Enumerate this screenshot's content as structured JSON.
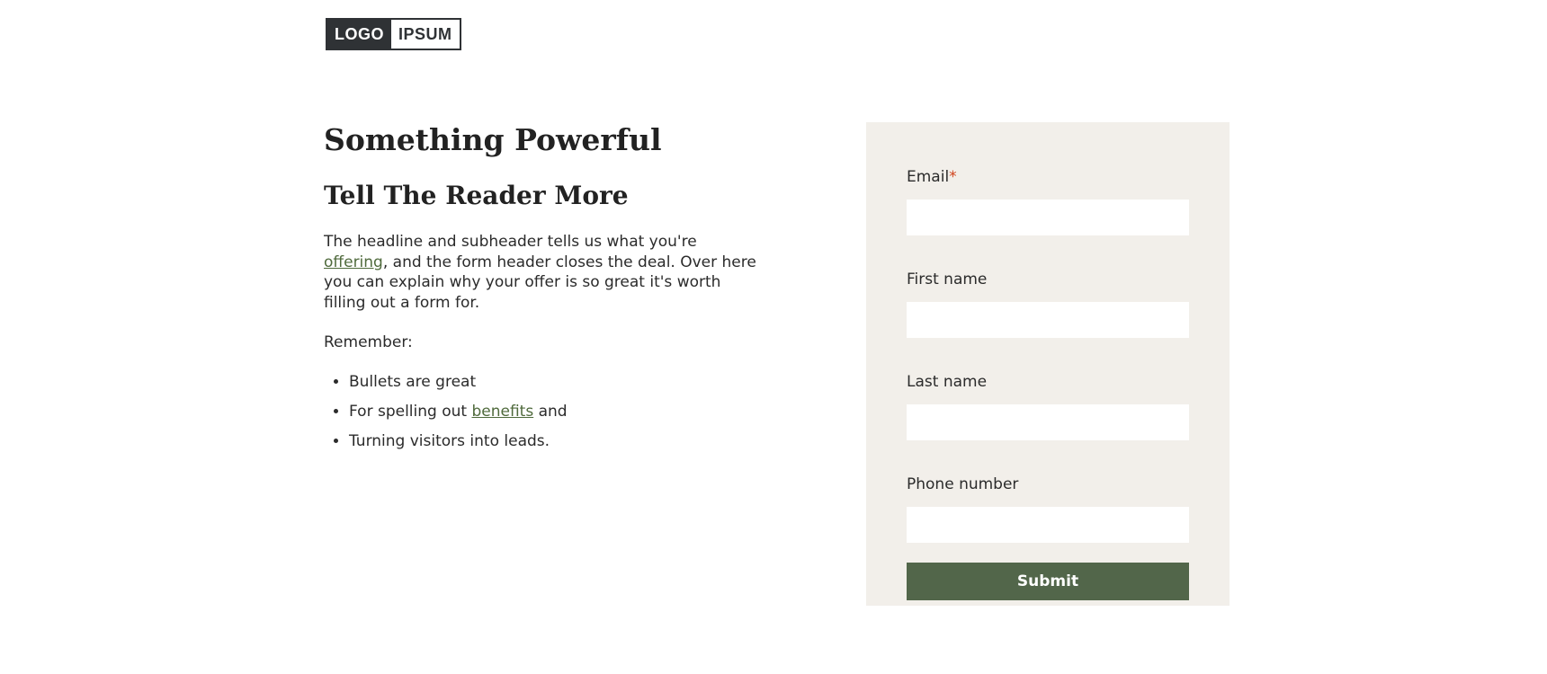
{
  "logo": {
    "left_text": "LOGO",
    "right_text": "IPSUM"
  },
  "content": {
    "headline": "Something Powerful",
    "subheadline": "Tell The Reader More",
    "paragraph_before_link": "The headline and subheader tells us what you're ",
    "paragraph_link": "offering",
    "paragraph_after_link": ", and the form header closes the deal. Over here you can explain why your offer is so great it's worth filling out a form for.",
    "remember": "Remember:",
    "bullets": {
      "item1": "Bullets are great",
      "item2_before": "For spelling out ",
      "item2_link": "benefits",
      "item2_after": " and",
      "item3": "Turning visitors into leads."
    }
  },
  "form": {
    "email_label": "Email",
    "email_required": "*",
    "email_value": "",
    "first_name_label": "First name",
    "first_name_value": "",
    "last_name_label": "Last name",
    "last_name_value": "",
    "phone_label": "Phone number",
    "phone_value": "",
    "submit_label": "Submit"
  },
  "colors": {
    "accent_green": "#52664a",
    "link_green": "#4f6a3c",
    "form_background": "#f2efea",
    "required_red": "#d0421b",
    "logo_dark": "#2f3235"
  }
}
